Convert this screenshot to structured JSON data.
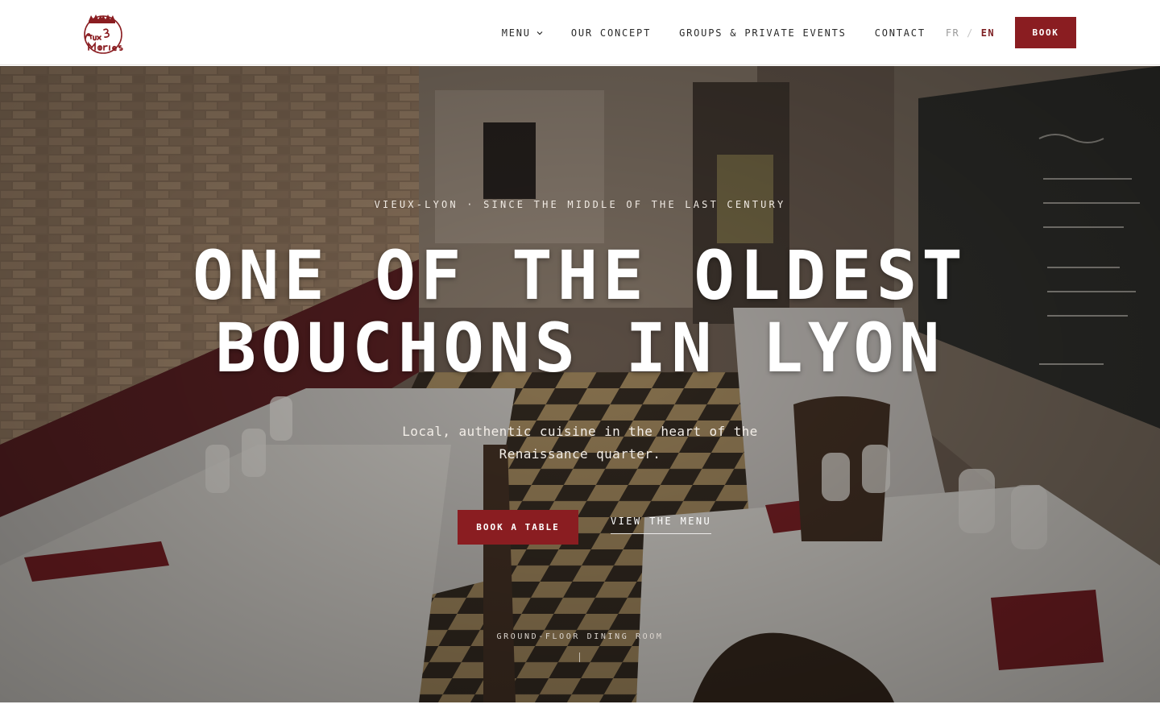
{
  "brand": {
    "name": "Aux 3 Maries",
    "primary_color": "#8a1d21",
    "logo_icon": "crown-script-logo"
  },
  "nav": {
    "items": [
      {
        "label": "MENU",
        "has_dropdown": true
      },
      {
        "label": "OUR CONCEPT"
      },
      {
        "label": "GROUPS & PRIVATE EVENTS"
      },
      {
        "label": "CONTACT"
      }
    ],
    "languages": {
      "fr": "FR",
      "separator": "/",
      "en": "EN",
      "active": "EN"
    },
    "book_label": "BOOK"
  },
  "hero": {
    "eyebrow": "VIEUX-LYON · SINCE THE MIDDLE OF THE LAST CENTURY",
    "headline_line1": "ONE OF THE OLDEST",
    "headline_line2": "BOUCHONS IN LYON",
    "subtitle": "Local, authentic cuisine in the heart of the Renaissance quarter.",
    "cta_primary": "BOOK A TABLE",
    "cta_secondary": "VIEW THE MENU",
    "caption": "GROUND-FLOOR DINING ROOM"
  }
}
